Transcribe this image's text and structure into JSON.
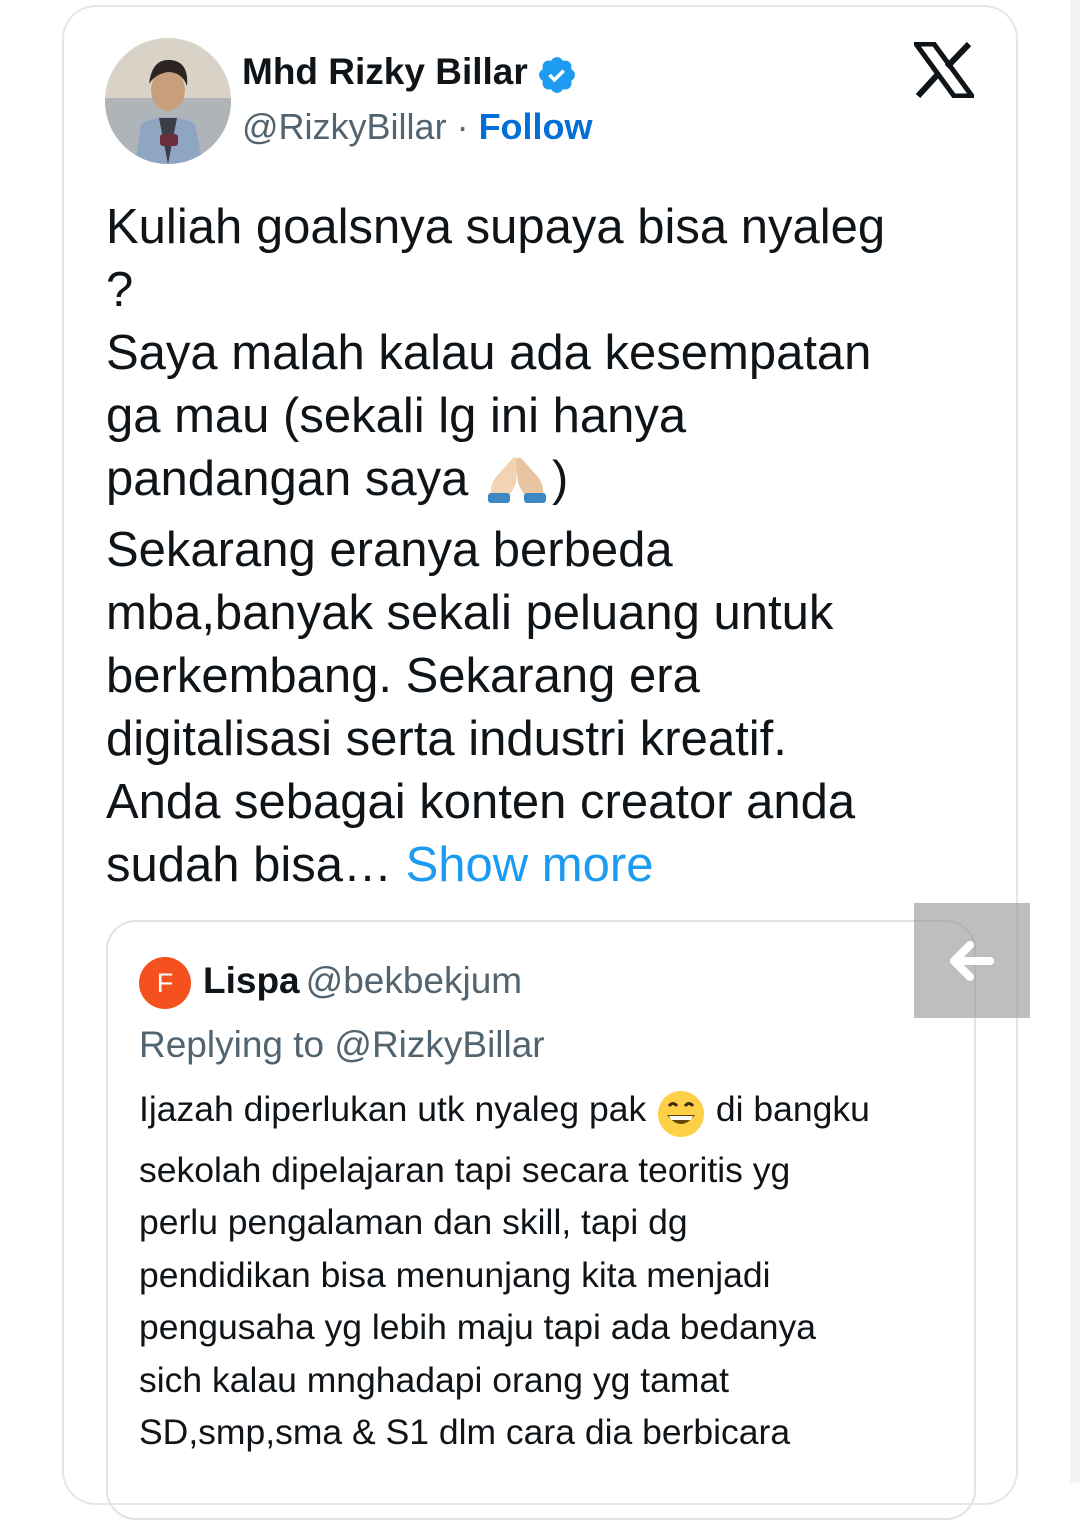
{
  "author": {
    "display_name": "Mhd Rizky Billar",
    "handle": "@RizkyBillar",
    "separator": " · ",
    "follow_label": "Follow",
    "verified": true,
    "verified_color": "#1d9bf0"
  },
  "tweet": {
    "text_before_emoji": "Kuliah goalsnya  supaya bisa nyaleg\n?\nSaya malah kalau ada kesempatan\nga mau (sekali lg ini hanya\npandangan saya ",
    "emoji": "folded-hands-emoji",
    "text_after_emoji": ")\nSekarang eranya berbeda\nmba,banyak sekali peluang untuk\nberkembang. Sekarang era\ndigitalisasi serta industri kreatif.\nAnda sebagai konten creator anda\nsudah bisa… ",
    "show_more_label": "Show more"
  },
  "quote": {
    "avatar_letter": "F",
    "avatar_color": "#f4511e",
    "name": "Lispa",
    "handle": "@bekbekjum",
    "replying_to": "Replying to @RizkyBillar",
    "text_before_emoji": "Ijazah diperlukan utk nyaleg pak ",
    "emoji": "grinning-emoji",
    "text_after_emoji": " di bangku\nsekolah dipelajaran tapi secara teoritis yg\nperlu pengalaman dan skill, tapi dg\npendidikan bisa menunjang kita menjadi\npengusaha yg lebih maju tapi ada bedanya\nsich kalau mnghadapi orang yg tamat\nSD,smp,sma & S1 dlm cara dia berbicara"
  },
  "icons": {
    "platform": "x-logo-icon",
    "back": "arrow-left-icon"
  }
}
